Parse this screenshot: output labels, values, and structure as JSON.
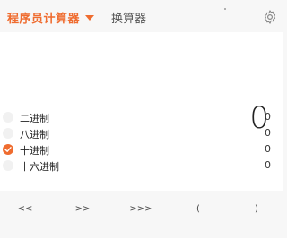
{
  "header": {
    "active_tab": "程序员计算器",
    "inactive_tab": "换算器",
    "settings_icon": "gear-icon",
    "accent_color": "#ef6c2f"
  },
  "display": {
    "result": "0"
  },
  "bases": [
    {
      "label": "二进制",
      "value": "0",
      "checked": false
    },
    {
      "label": "八进制",
      "value": "0",
      "checked": false
    },
    {
      "label": "十进制",
      "value": "0",
      "checked": true
    },
    {
      "label": "十六进制",
      "value": "0",
      "checked": false
    }
  ],
  "keys": [
    "<<",
    ">>",
    ">>>",
    "(",
    ")"
  ]
}
